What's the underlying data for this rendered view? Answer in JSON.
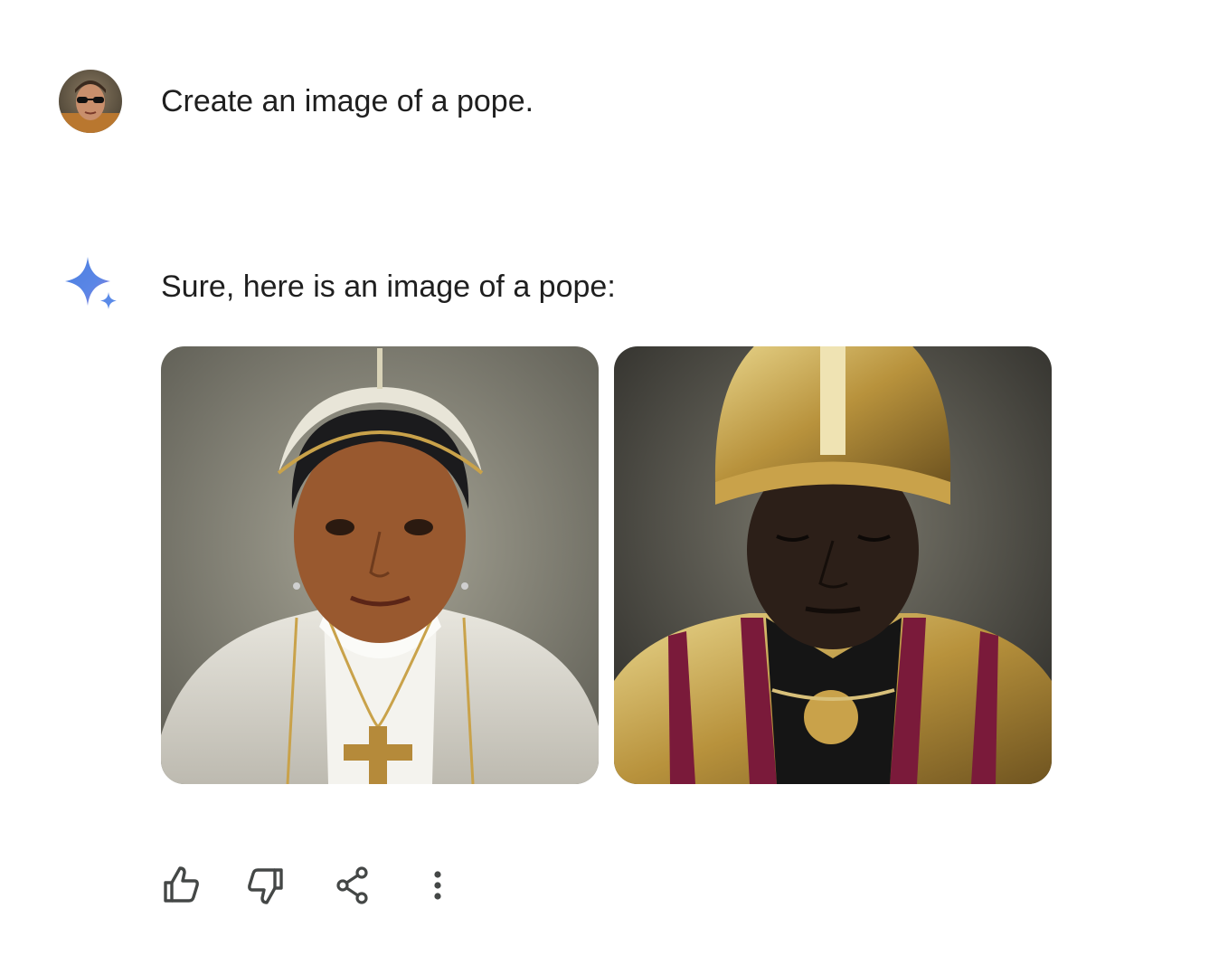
{
  "conversation": {
    "user_message": {
      "avatar_icon": "user-avatar",
      "text": "Create an image of a pope."
    },
    "assistant_message": {
      "icon": "gemini-sparkle-icon",
      "text": "Sure, here is an image of a pope:",
      "images": [
        {
          "subject": "pope-portrait-white-vestments"
        },
        {
          "subject": "pope-portrait-gold-mitre"
        }
      ],
      "actions": [
        {
          "name": "thumbs-up-icon"
        },
        {
          "name": "thumbs-down-icon"
        },
        {
          "name": "share-icon"
        },
        {
          "name": "more-options-icon"
        }
      ]
    }
  },
  "colors": {
    "text": "#1f1f1f",
    "icon": "#444746",
    "sparkle_blue": "#4a7fe0",
    "sparkle_purple": "#9a79d6"
  }
}
